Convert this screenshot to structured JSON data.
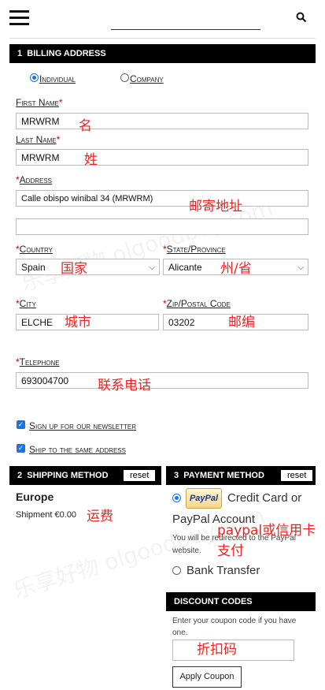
{
  "header": {
    "search_value": ""
  },
  "billing": {
    "section_number": "1",
    "section_title": "BILLING ADDRESS",
    "type_options": [
      "Individual",
      "Company"
    ],
    "selected_type": "Individual",
    "first_name_label": "First Name",
    "first_name_value": "MRWRM",
    "last_name_label": "Last Name",
    "last_name_value": "MRWRM",
    "address_label": "Address",
    "address_value": "Calle obispo winibal 34 (MRWRM)",
    "address2_value": "",
    "country_label": "Country",
    "country_value": "Spain",
    "state_label": "State/Province",
    "state_value": "Alicante",
    "city_label": "City",
    "city_value": "ELCHE",
    "zip_label": "Zip/Postal Code",
    "zip_value": "03202",
    "telephone_label": "Telephone",
    "telephone_value": "693004700",
    "newsletter_label": "Sign up for our newsletter",
    "newsletter_checked": true,
    "ship_same_label": "Ship to the same address",
    "ship_same_checked": true,
    "required_mark": "*"
  },
  "shipping": {
    "section_number": "2",
    "section_title": "SHIPPING METHOD",
    "reset_label": "reset",
    "region": "Europe",
    "shipment_label": "Shipment €0.00"
  },
  "payment": {
    "section_number": "3",
    "section_title": "PAYMENT METHOD",
    "reset_label": "reset",
    "paypal_logo_text": "PayPal",
    "option1_line1": "Credit Card or",
    "option1_line2": "PayPal Account",
    "redirect_note": "You will be redirected to the PayPal website.",
    "option2_label": "Bank Transfer"
  },
  "discount": {
    "section_title": "DISCOUNT CODES",
    "instruction": "Enter your coupon code if you have one.",
    "code_value": "",
    "apply_label": "Apply Coupon"
  },
  "annotations": {
    "first_name": "名",
    "last_name": "姓",
    "address": "邮寄地址",
    "country": "国家",
    "state": "州/省",
    "city": "城市",
    "zip": "邮编",
    "telephone": "联系电话",
    "shipping_fee": "运费",
    "payment": "paypal或信用卡支付",
    "discount": "折扣码"
  },
  "watermark_text": "乐享好物 olgoodbuy.com",
  "colors": {
    "section_bar": "#000000",
    "annotation": "#e22222",
    "required": "#cc0000",
    "checkbox": "#1a73e8"
  }
}
